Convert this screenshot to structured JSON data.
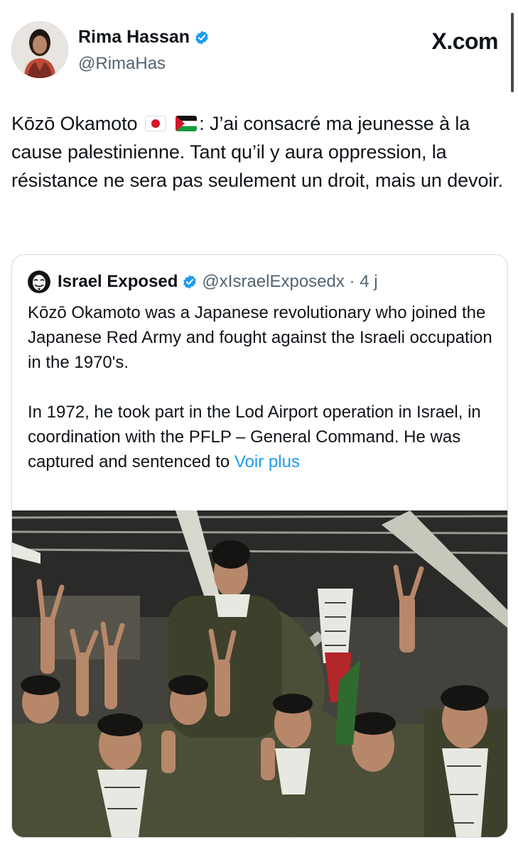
{
  "author": {
    "name": "Rima Hassan",
    "handle": "@RimaHas",
    "verified": true,
    "avatar": "avatar-photo"
  },
  "site_label": "X.com",
  "tweet": {
    "text_before_flags": "Kōzō Okamoto",
    "flags": [
      "japan-flag-icon",
      "palestine-flag-icon"
    ],
    "text_after_flags": ": J’ai consacré ma jeunesse à la cause palestinienne. Tant qu’il y aura oppression, la résistance ne sera pas seulement un droit, mais un devoir."
  },
  "quote": {
    "name": "Israel Exposed",
    "handle_time": "@xIsraelExposedx · 4 j",
    "verified": true,
    "paragraph1": "Kōzō Okamoto was a Japanese revolutionary who joined the Japanese Red Army and fought against the Israeli occupation in the 1970's.",
    "paragraph2": "In 1972, he took part in the Lod Airport operation in Israel, in coordination with the PFLP – General Command. He was captured and sentenced to",
    "more_label": "Voir plus",
    "image": "group-photo"
  },
  "colors": {
    "accent": "#1d9bf0",
    "text": "#0f1419",
    "secondary": "#536471",
    "border": "#cfd9de"
  }
}
